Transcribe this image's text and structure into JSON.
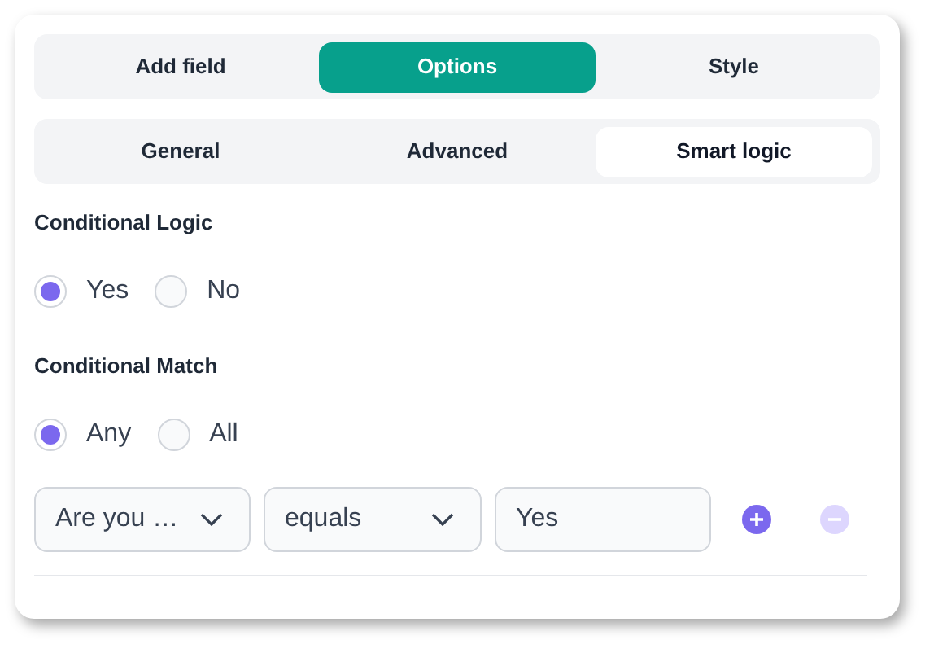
{
  "main_tabs": [
    {
      "label": "Add field",
      "selected": false
    },
    {
      "label": "Options",
      "selected": true
    },
    {
      "label": "Style",
      "selected": false
    }
  ],
  "sub_tabs": [
    {
      "label": "General",
      "selected": false
    },
    {
      "label": "Advanced",
      "selected": false
    },
    {
      "label": "Smart logic",
      "selected": true
    }
  ],
  "conditional_logic": {
    "label": "Conditional Logic",
    "options": [
      {
        "label": "Yes",
        "selected": true
      },
      {
        "label": "No",
        "selected": false
      }
    ]
  },
  "conditional_match": {
    "label": "Conditional Match",
    "options": [
      {
        "label": "Any",
        "selected": true
      },
      {
        "label": "All",
        "selected": false
      }
    ]
  },
  "rule": {
    "field": {
      "value": "Are you …"
    },
    "operator": {
      "value": "equals"
    },
    "value": {
      "value": "Yes"
    },
    "buttons": [
      {
        "kind": "add",
        "disabled": false
      },
      {
        "kind": "remove",
        "disabled": true
      }
    ]
  }
}
